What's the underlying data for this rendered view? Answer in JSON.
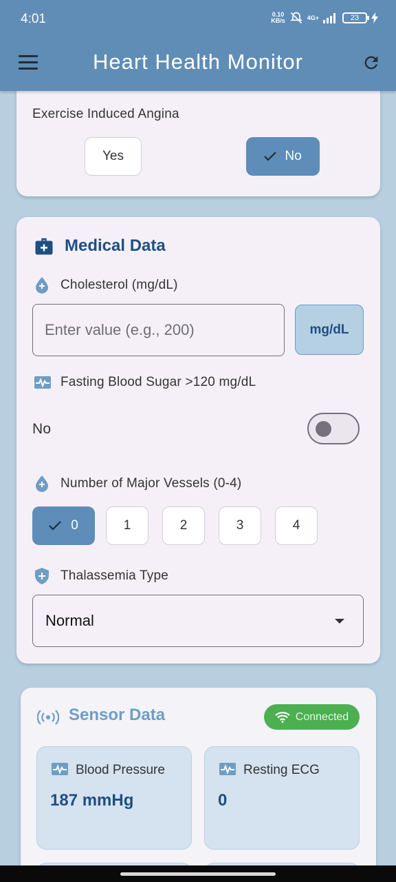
{
  "status_bar": {
    "time": "4:01",
    "net_speed_value": "0.10",
    "net_speed_unit": "KB/s",
    "network": "4G+",
    "battery": "23"
  },
  "app_bar": {
    "title": "Heart Health Monitor",
    "menu_icon": "menu-icon",
    "refresh_icon": "refresh-icon"
  },
  "exercise_angina": {
    "label": "Exercise Induced Angina",
    "options": [
      "Yes",
      "No"
    ],
    "selected": "No"
  },
  "medical_data": {
    "title": "Medical Data",
    "cholesterol": {
      "label": "Cholesterol (mg/dL)",
      "placeholder": "Enter value (e.g., 200)",
      "unit": "mg/dL"
    },
    "fasting_blood_sugar": {
      "label": "Fasting Blood Sugar >120 mg/dL",
      "value_text": "No",
      "enabled": false
    },
    "major_vessels": {
      "label": "Number of Major Vessels (0-4)",
      "options": [
        "0",
        "1",
        "2",
        "3",
        "4"
      ],
      "selected": "0"
    },
    "thalassemia": {
      "label": "Thalassemia Type",
      "value": "Normal"
    }
  },
  "sensor_data": {
    "title": "Sensor Data",
    "status": "Connected",
    "tiles": [
      {
        "label": "Blood Pressure",
        "value": "187 mmHg"
      },
      {
        "label": "Resting ECG",
        "value": "0"
      }
    ]
  },
  "colors": {
    "app_bar": "#5f8db6",
    "selected_chip": "#5d8db8",
    "section_title": "#1e4f83",
    "connected_badge": "#4caf50"
  }
}
